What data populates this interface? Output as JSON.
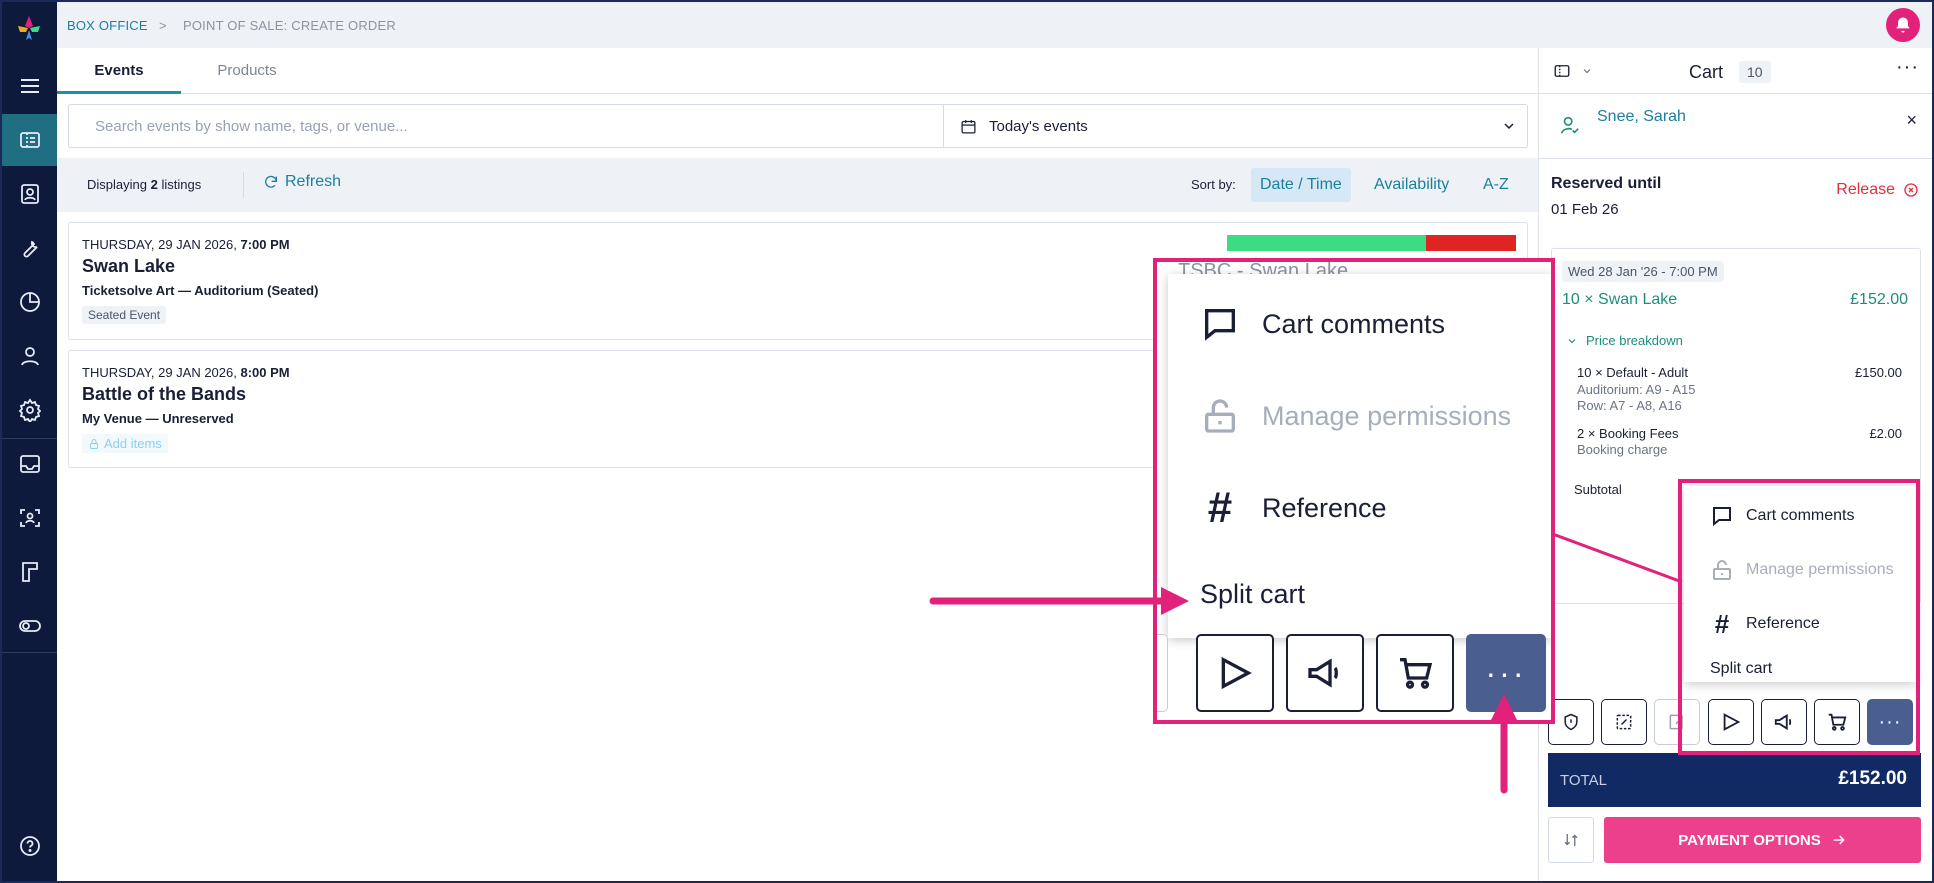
{
  "breadcrumb": {
    "root": "BOX OFFICE",
    "separator": ">",
    "current": "POINT OF SALE: CREATE ORDER"
  },
  "tabs": [
    {
      "label": "Events"
    },
    {
      "label": "Products"
    }
  ],
  "search": {
    "placeholder": "Search events by show name, tags, or venue...",
    "value": ""
  },
  "date_filter": {
    "label": "Today's events"
  },
  "listing_bar": {
    "displaying_prefix": "Displaying",
    "count": "2",
    "displaying_suffix": "listings",
    "refresh_label": "Refresh",
    "sort_label": "Sort by:",
    "sort_options": [
      "Date / Time",
      "Availability",
      "A-Z"
    ],
    "selected_sort": "Date / Time"
  },
  "events": [
    {
      "date": "THURSDAY, 29 JAN 2026,",
      "time": "7:00 PM",
      "name": "Swan Lake",
      "venue": "Ticketsolve Art — Auditorium (Seated)",
      "badge": "Seated Event",
      "sold_fraction": 0.69
    },
    {
      "date": "THURSDAY, 29 JAN 2026,",
      "time": "8:00 PM",
      "name": "Battle of the Bands",
      "venue": "My Venue — Unreserved",
      "action": "Add items"
    }
  ],
  "cart": {
    "title": "Cart",
    "count": "10",
    "customer": "Snee, Sarah",
    "reserved_label": "Reserved until",
    "reserved_date": "01 Feb 26",
    "release_label": "Release",
    "item": {
      "date_tag": "Wed 28 Jan '26 - 7:00 PM",
      "line": "10 × Swan Lake",
      "line_price": "£152.00",
      "breakdown_label": "Price breakdown",
      "rows": [
        {
          "title": "10 × Default - Adult",
          "price": "£150.00",
          "sub1": "Auditorium: A9 - A15",
          "sub2": "Row: A7 - A8, A16"
        },
        {
          "title": "2 × Booking Fees",
          "price": "£2.00",
          "sub1": "Booking charge"
        }
      ],
      "subtotal_label": "Subtotal"
    },
    "total_label": "TOTAL",
    "total_value": "£152.00",
    "payment_label": "PAYMENT OPTIONS"
  },
  "menu": {
    "items": [
      {
        "label": "Cart comments",
        "icon": "comment-icon",
        "disabled": false
      },
      {
        "label": "Manage permissions",
        "icon": "unlock-icon",
        "disabled": true
      },
      {
        "label": "Reference",
        "icon": "hash-icon",
        "disabled": false
      },
      {
        "label": "Split cart",
        "icon": "",
        "disabled": false
      }
    ]
  },
  "zoom_peek_text": "TSBC - Swan Lake",
  "colors": {
    "sidebar": "#0d1a3c",
    "accent": "#1d8fa8",
    "pink": "#e2217b",
    "total_bar": "#112a63",
    "capacity_sold": "#3ddc84",
    "capacity_held": "#e02424"
  }
}
